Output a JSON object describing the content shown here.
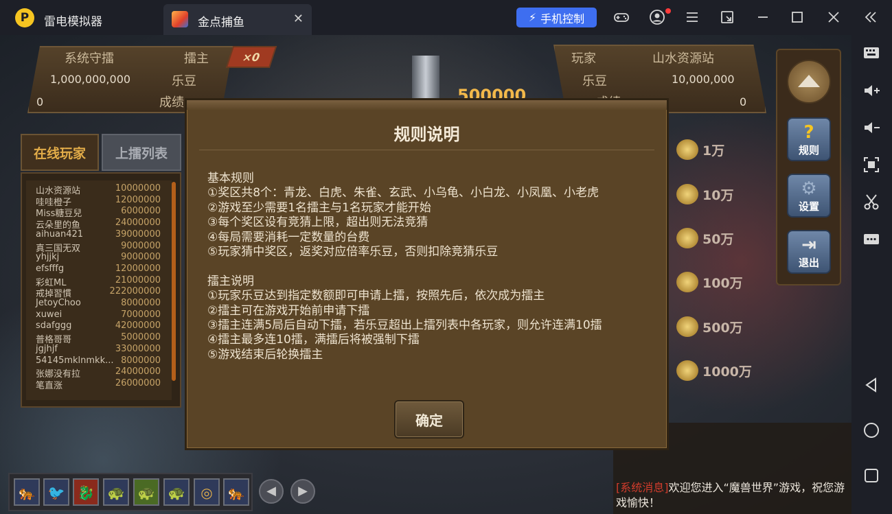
{
  "titlebar": {
    "app_name": "雷电模拟器",
    "logo_glyph": "P",
    "tab_label": "金点捕鱼",
    "tab_close": "✕",
    "phone_control": "手机控制",
    "phone_icon": "⚡"
  },
  "scoreboard_left": {
    "label_system": "系统守擂",
    "label_host": "擂主",
    "amount": "1,000,000,000",
    "label_ledou": "乐豆",
    "score": "0",
    "label_score": "成绩",
    "badge": "×0"
  },
  "scoreboard_right": {
    "label_player": "玩家",
    "player_name": "山水资源站",
    "label_ledou": "乐豆",
    "amount": "10,000,000",
    "label_score": "成绩",
    "score": "0"
  },
  "center": {
    "digits": "500000"
  },
  "list_tabs": {
    "online": "在线玩家",
    "queue": "上擂列表"
  },
  "players": [
    {
      "name": "山水资源站",
      "value": "10000000"
    },
    {
      "name": "哇哇橙子",
      "value": "12000000"
    },
    {
      "name": "Miss糖豆兒",
      "value": "6000000"
    },
    {
      "name": "云朵里的鱼",
      "value": "24000000"
    },
    {
      "name": "aihuan421",
      "value": "39000000"
    },
    {
      "name": "真三国无双",
      "value": "9000000"
    },
    {
      "name": "yhjjkj",
      "value": "9000000"
    },
    {
      "name": "efsfffg",
      "value": "12000000"
    },
    {
      "name": "彩虹ML",
      "value": "21000000"
    },
    {
      "name": "戒掉習慣",
      "value": "222000000"
    },
    {
      "name": "JetoyChoo",
      "value": "8000000"
    },
    {
      "name": "xuwei",
      "value": "7000000"
    },
    {
      "name": "sdafggg",
      "value": "42000000"
    },
    {
      "name": "普格哥哥",
      "value": "5000000"
    },
    {
      "name": "jgjhjf",
      "value": "33000000"
    },
    {
      "name": "54145mklnmkk...",
      "value": "8000000"
    },
    {
      "name": "张娜没有拉",
      "value": "24000000"
    },
    {
      "name": "笔直涨",
      "value": "26000000"
    }
  ],
  "side_buttons": {
    "rules": "规则",
    "settings": "设置",
    "exit": "退出"
  },
  "bets": [
    "1万",
    "10万",
    "50万",
    "100万",
    "500万",
    "1000万"
  ],
  "chat": {
    "sys_tag": "[系统消息]",
    "message": "欢迎您进入“魔兽世界”游戏，祝您游戏愉快！"
  },
  "modal": {
    "title": "规则说明",
    "basic_header": "基本规则",
    "basic_rules": [
      "①奖区共8个：青龙、白虎、朱雀、玄武、小乌龟、小白龙、小凤凰、小老虎",
      "②游戏至少需要1名擂主与1名玩家才能开始",
      "③每个奖区设有竞猜上限，超出则无法竞猜",
      "④每局需要消耗一定数量的台费",
      "⑤玩家猜中奖区，返奖对应倍率乐豆，否则扣除竞猜乐豆"
    ],
    "host_header": "擂主说明",
    "host_rules": [
      "①玩家乐豆达到指定数额即可申请上擂，按照先后，依次成为擂主",
      "②擂主可在游戏开始前申请下擂",
      "③擂主连满5局后自动下擂，若乐豆超出上擂列表中各玩家，则允许连满10擂",
      "④擂主最多连10擂，满擂后将被强制下擂",
      "⑤游戏结束后轮换擂主"
    ],
    "ok": "确定"
  }
}
